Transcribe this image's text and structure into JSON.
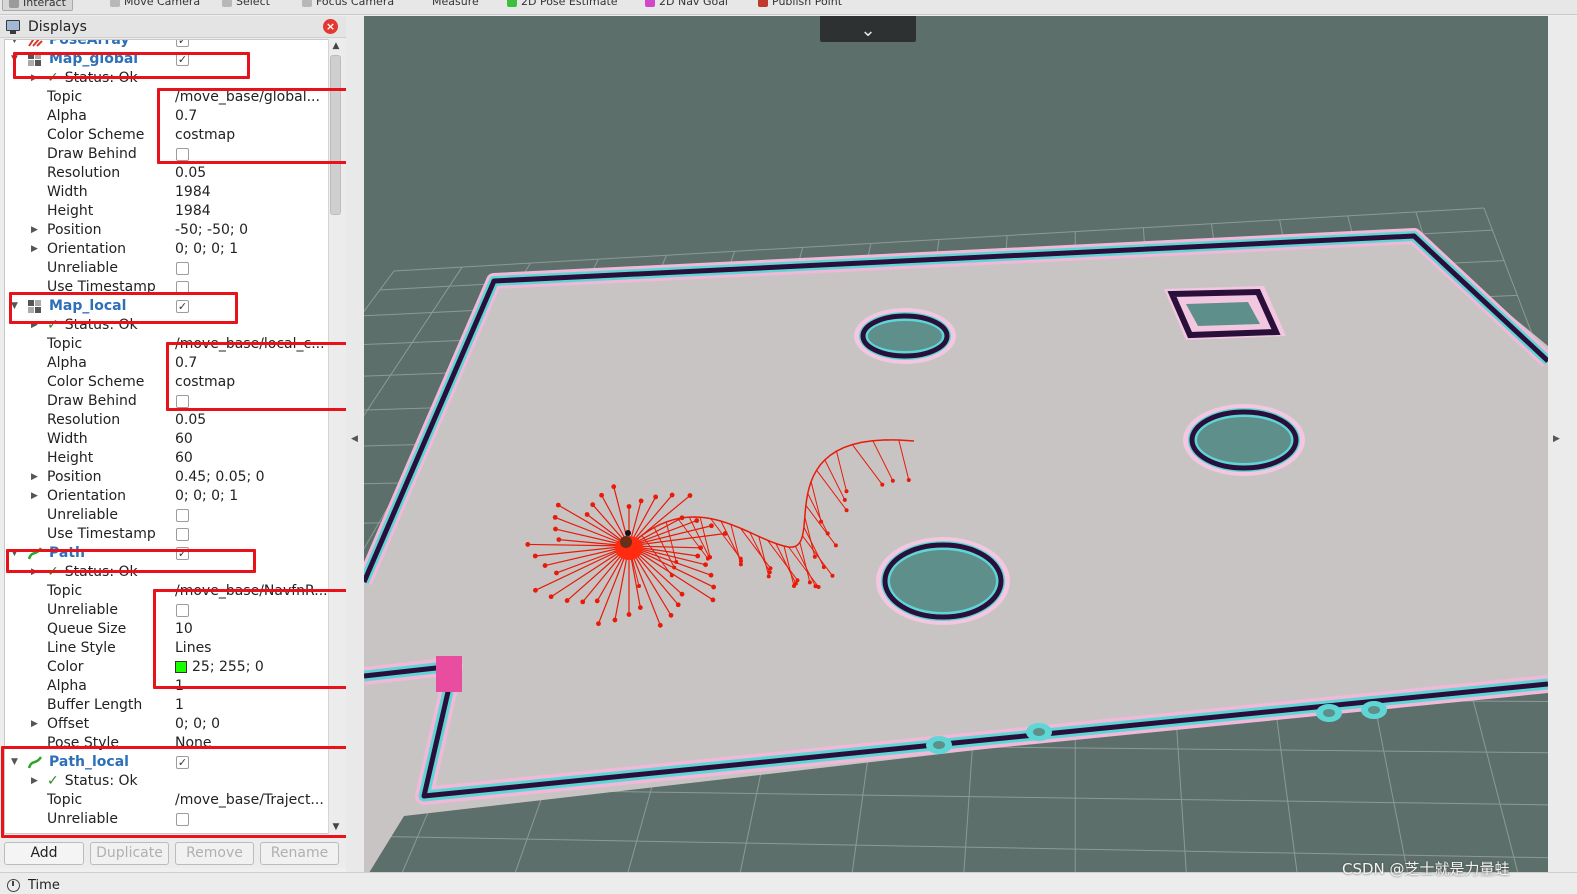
{
  "toolbar": {
    "tools": [
      "Interact",
      "Move Camera",
      "Select",
      "Focus Camera",
      "Measure",
      "2D Pose Estimate",
      "2D Nav Goal",
      "Publish Point"
    ]
  },
  "panel": {
    "title": "Displays",
    "close_icon": "close-icon"
  },
  "tree": {
    "pose_array": {
      "name": "PoseArray",
      "enabled": true
    },
    "map_global": {
      "name": "Map_global",
      "enabled": true,
      "status": "Status: Ok",
      "properties": [
        {
          "label": "Topic",
          "value": "/move_base/global..."
        },
        {
          "label": "Alpha",
          "value": "0.7"
        },
        {
          "label": "Color Scheme",
          "value": "costmap"
        },
        {
          "label": "Draw Behind",
          "value": "",
          "checkbox": false
        },
        {
          "label": "Resolution",
          "value": "0.05"
        },
        {
          "label": "Width",
          "value": "1984"
        },
        {
          "label": "Height",
          "value": "1984"
        },
        {
          "label": "Position",
          "value": "-50; -50; 0",
          "expandable": true
        },
        {
          "label": "Orientation",
          "value": "0; 0; 0; 1",
          "expandable": true
        },
        {
          "label": "Unreliable",
          "value": "",
          "checkbox": false
        },
        {
          "label": "Use Timestamp",
          "value": "",
          "checkbox": false
        }
      ]
    },
    "map_local": {
      "name": "Map_local",
      "enabled": true,
      "status": "Status: Ok",
      "properties": [
        {
          "label": "Topic",
          "value": "/move_base/local_c..."
        },
        {
          "label": "Alpha",
          "value": "0.7"
        },
        {
          "label": "Color Scheme",
          "value": "costmap"
        },
        {
          "label": "Draw Behind",
          "value": "",
          "checkbox": false
        },
        {
          "label": "Resolution",
          "value": "0.05"
        },
        {
          "label": "Width",
          "value": "60"
        },
        {
          "label": "Height",
          "value": "60"
        },
        {
          "label": "Position",
          "value": "0.45; 0.05; 0",
          "expandable": true
        },
        {
          "label": "Orientation",
          "value": "0; 0; 0; 1",
          "expandable": true
        },
        {
          "label": "Unreliable",
          "value": "",
          "checkbox": false
        },
        {
          "label": "Use Timestamp",
          "value": "",
          "checkbox": false
        }
      ]
    },
    "path": {
      "name": "Path",
      "enabled": true,
      "status": "Status: Ok",
      "properties": [
        {
          "label": "Topic",
          "value": "/move_base/NavfnR..."
        },
        {
          "label": "Unreliable",
          "value": "",
          "checkbox": false
        },
        {
          "label": "Queue Size",
          "value": "10"
        },
        {
          "label": "Line Style",
          "value": "Lines"
        },
        {
          "label": "Color",
          "value": "25; 255; 0",
          "swatch": "#19ff00"
        },
        {
          "label": "Alpha",
          "value": "1"
        },
        {
          "label": "Buffer Length",
          "value": "1"
        },
        {
          "label": "Offset",
          "value": "0; 0; 0",
          "expandable": true
        },
        {
          "label": "Pose Style",
          "value": "None"
        }
      ]
    },
    "path_local": {
      "name": "Path_local",
      "enabled": true,
      "status": "Status: Ok",
      "properties": [
        {
          "label": "Topic",
          "value": "/move_base/Traject..."
        },
        {
          "label": "Unreliable",
          "value": "",
          "checkbox": false
        }
      ]
    }
  },
  "buttons": {
    "add": "Add",
    "duplicate": "Duplicate",
    "remove": "Remove",
    "rename": "Rename"
  },
  "time_panel": {
    "label": "Time"
  },
  "viewport": {
    "background": "#5d6f6b",
    "grid_color": "#8c9a97",
    "floor_color": "#c9c4c4",
    "wall_color": "#2a0f3a",
    "inflation_color": "#5fd6d6",
    "arrow_color": "#e81a08"
  },
  "watermark": "CSDN @芝士就是力量蛙"
}
